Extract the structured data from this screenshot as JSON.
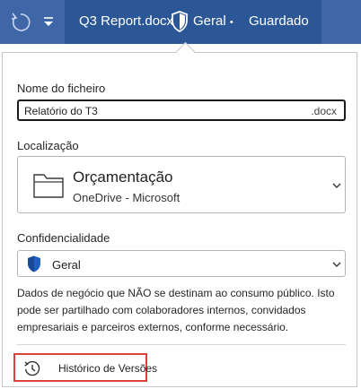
{
  "title_bar": {
    "document_name": "Q3 Report.docx",
    "sensitivity_label": "Geral",
    "sensitivity_dot": "•",
    "save_status": "Guardado",
    "colors": {
      "bar": "#2b5797",
      "accent_block": "#3f66a6"
    },
    "icons": [
      "undo-icon",
      "quick-access-dropdown-icon",
      "shield-icon"
    ]
  },
  "file_panel": {
    "file_name": {
      "label": "Nome do ficheiro",
      "value": "Relatório do T3",
      "extension": ".docx"
    },
    "location": {
      "label": "Localização",
      "folder": "Orçamentação",
      "service": "OneDrive - Microsoft",
      "icon": "folder-icon"
    },
    "sensitivity": {
      "label": "Confidencialidade",
      "value": "Geral",
      "icon": "shield-icon",
      "shield_color": "#1f5fbf",
      "description": "Dados de negócio que NÃO se destinam ao consumo público. Isto pode ser partilhado com colaboradores internos, convidados empresariais e parceiros externos, conforme necessário."
    },
    "version_history": {
      "label": "Histórico de Versões",
      "icon": "history-icon",
      "highlight_color": "#e0403a"
    }
  }
}
